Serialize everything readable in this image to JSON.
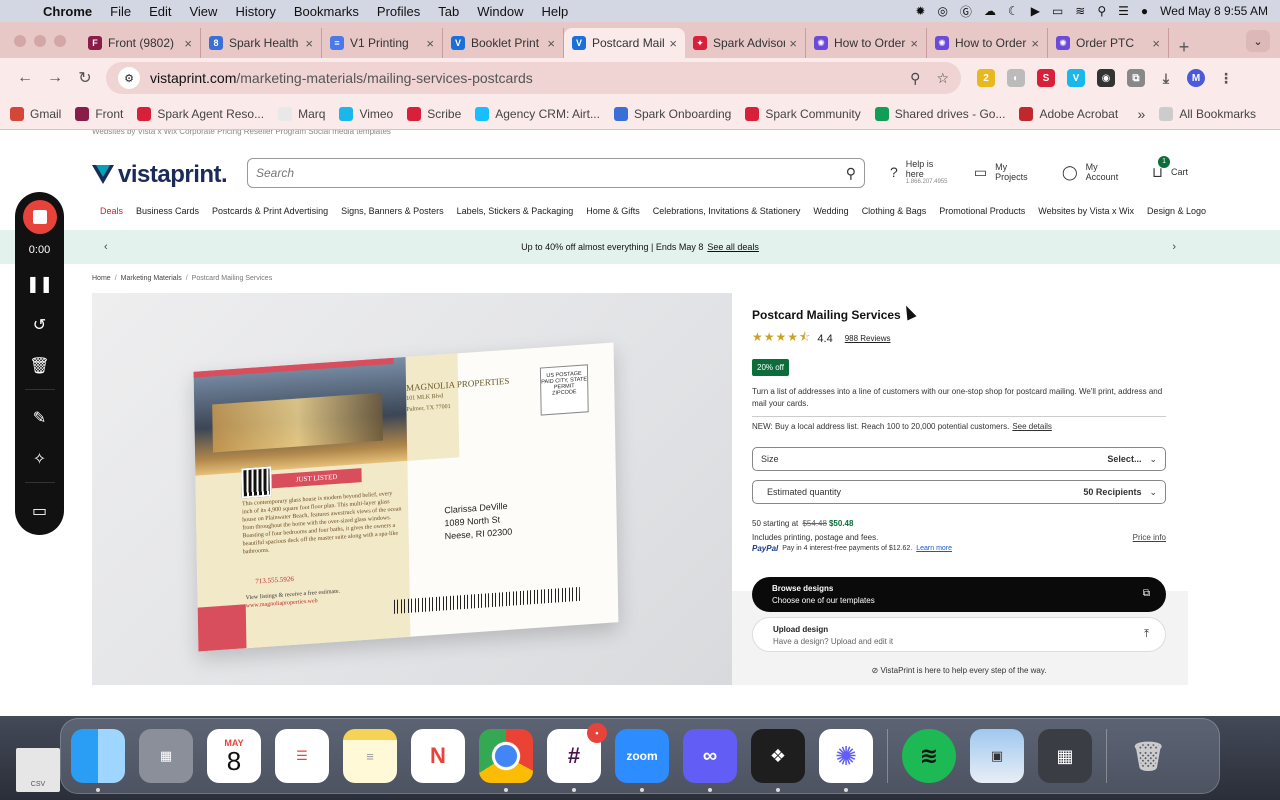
{
  "menubar": {
    "app": "Chrome",
    "items": [
      "File",
      "Edit",
      "View",
      "History",
      "Bookmarks",
      "Profiles",
      "Tab",
      "Window",
      "Help"
    ],
    "datetime": "Wed May 8  9:55 AM"
  },
  "tabs": [
    {
      "title": "Front (9802)",
      "color": "#8a1c4a",
      "glyph": "F"
    },
    {
      "title": "Spark Health",
      "color": "#3b6fd8",
      "glyph": "8"
    },
    {
      "title": "V1 Printing",
      "color": "#4a7ae8",
      "glyph": "≡"
    },
    {
      "title": "Booklet Print",
      "color": "#1a6fd8",
      "glyph": "V"
    },
    {
      "title": "Postcard Mail",
      "color": "#1a6fd8",
      "glyph": "V"
    },
    {
      "title": "Spark Advisor",
      "color": "#d8203a",
      "glyph": "✦"
    },
    {
      "title": "How to Order",
      "color": "#6a4ad8",
      "glyph": "✺"
    },
    {
      "title": "How to Order",
      "color": "#6a4ad8",
      "glyph": "✺"
    },
    {
      "title": "Order PTC",
      "color": "#6a4ad8",
      "glyph": "✺"
    }
  ],
  "active_tab_index": 4,
  "omnibox": {
    "domain": "vistaprint.com",
    "path": "/marketing-materials/mailing-services-postcards"
  },
  "bookmarks": [
    {
      "label": "Gmail",
      "color": "#d44638"
    },
    {
      "label": "Front",
      "color": "#8a1c4a"
    },
    {
      "label": "Spark Agent Reso...",
      "color": "#d8203a"
    },
    {
      "label": "Marq",
      "color": "#e8e8e8"
    },
    {
      "label": "Vimeo",
      "color": "#1ab7ea"
    },
    {
      "label": "Scribe",
      "color": "#d8203a"
    },
    {
      "label": "Agency CRM: Airt...",
      "color": "#18bfff"
    },
    {
      "label": "Spark Onboarding",
      "color": "#3b6fd8"
    },
    {
      "label": "Spark Community",
      "color": "#d8203a"
    },
    {
      "label": "Shared drives - Go...",
      "color": "#0f9d58"
    },
    {
      "label": "Adobe Acrobat",
      "color": "#c0282d"
    }
  ],
  "all_bookmarks": "All Bookmarks",
  "site": {
    "logo": "vistaprint.",
    "search_placeholder": "Search",
    "help_label": "Help is here",
    "help_phone": "1.866.207.4955",
    "projects": "My Projects",
    "account": "My Account",
    "cart": "Cart",
    "cart_count": "1",
    "nav": [
      "Deals",
      "Business Cards",
      "Postcards & Print Advertising",
      "Signs, Banners & Posters",
      "Labels, Stickers & Packaging",
      "Home & Gifts",
      "Celebrations, Invitations & Stationery",
      "Wedding",
      "Clothing & Bags",
      "Promotional Products",
      "Websites by Vista x Wix",
      "Design & Logo"
    ],
    "promo_text": "Up to 40% off almost everything | Ends May 8",
    "promo_link": "See all deals",
    "breadcrumbs": [
      "Home",
      "Marketing Materials",
      "Postcard Mailing Services"
    ],
    "top_strip": "Websites by Vista x Wix    Corporate Pricing    Reseller Program    Social media templates"
  },
  "product": {
    "title": "Postcard Mailing Services",
    "rating": "4.4",
    "rating_value": 4.4,
    "reviews": "988 Reviews",
    "badge": "20% off",
    "description": "Turn a list of addresses into a line of customers with our one-stop shop for postcard mailing. We'll print, address and mail your cards.",
    "new_text": "NEW: Buy a local address list. Reach 100 to 20,000 potential customers.",
    "see_details": "See details",
    "size_label": "Size",
    "size_value": "Select...",
    "qty_label": "Estimated quantity",
    "qty_value": "50 Recipients",
    "price_prefix": "50 starting at",
    "price_old": "$54.48",
    "price_new": "$50.48",
    "includes": "Includes printing, postage and fees.",
    "price_info": "Price info",
    "paypal_brand": "PayPal",
    "paypal_text": "Pay in 4 interest-free payments of $12.62.",
    "learn_more": "Learn more",
    "browse_title": "Browse designs",
    "browse_sub": "Choose one of our templates",
    "upload_title": "Upload design",
    "upload_sub": "Have a design? Upload and edit it",
    "help_line": "VistaPrint is here to help every step of the way."
  },
  "postcard": {
    "brand": "MAGNOLIA PROPERTIES",
    "address1": "101 MLK Blvd",
    "address2": "Palmer, TX 77001",
    "listed": "JUST LISTED",
    "body": "This contemporary glass house is modern beyond belief, every inch of its 4,900 square foot floor plan. This multi-layer glass house on Plainwater Beach, features awestruck views of the ocean from throughout the home with the over-sized glass windows. Boasting of four bedrooms and four baths, it gives the owners a beautiful spacious deck off the master suite along with a spa-like bathrooms.",
    "phone": "713.555.5926",
    "cta": "View listings & receive a free estimate.",
    "web": "www.magnoliaproperties.web",
    "stamp": "US POSTAGE PAID CITY, STATE PERMIT ZIPCODE",
    "recipient": [
      "Clarissa DeVille",
      "1089 North St",
      "Neese, RI 02300"
    ]
  },
  "recorder": {
    "time": "0:00"
  },
  "dock": {
    "calendar_month": "MAY",
    "calendar_day": "8",
    "zoom_label": "zoom",
    "slack_badge": "•",
    "csv_label": "CSV"
  }
}
